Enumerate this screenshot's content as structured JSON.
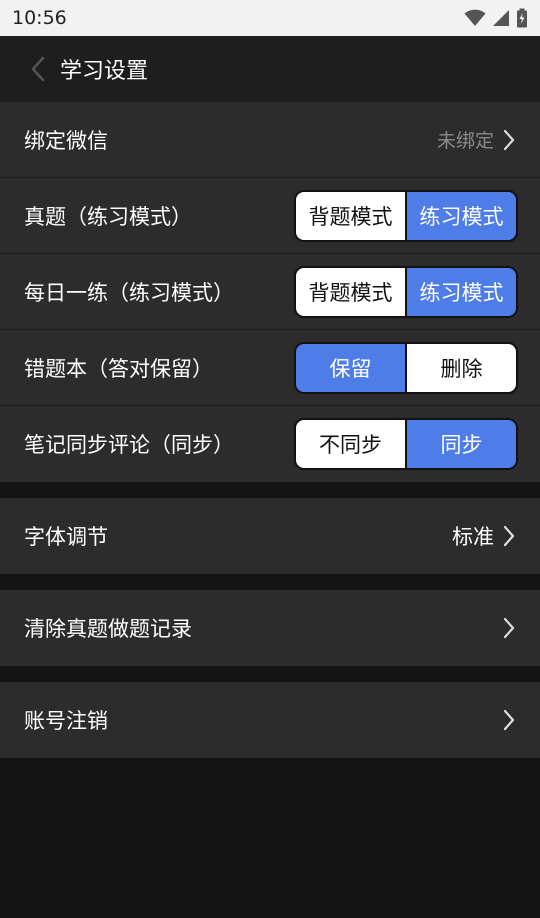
{
  "status": {
    "time": "10:56"
  },
  "header": {
    "title": "学习设置"
  },
  "wechat": {
    "label": "绑定微信",
    "value": "未绑定"
  },
  "settings": [
    {
      "label": "真题（练习模式）",
      "options": [
        "背题模式",
        "练习模式"
      ],
      "selected": 1
    },
    {
      "label": "每日一练（练习模式）",
      "options": [
        "背题模式",
        "练习模式"
      ],
      "selected": 1
    },
    {
      "label": "错题本（答对保留）",
      "options": [
        "保留",
        "删除"
      ],
      "selected": 0
    },
    {
      "label": "笔记同步评论（同步）",
      "options": [
        "不同步",
        "同步"
      ],
      "selected": 1
    }
  ],
  "font": {
    "label": "字体调节",
    "value": "标准"
  },
  "clear": {
    "label": "清除真题做题记录"
  },
  "account": {
    "label": "账号注销"
  },
  "colors": {
    "accent": "#4f7de8",
    "background": "#141414",
    "row": "#2c2c2c"
  }
}
